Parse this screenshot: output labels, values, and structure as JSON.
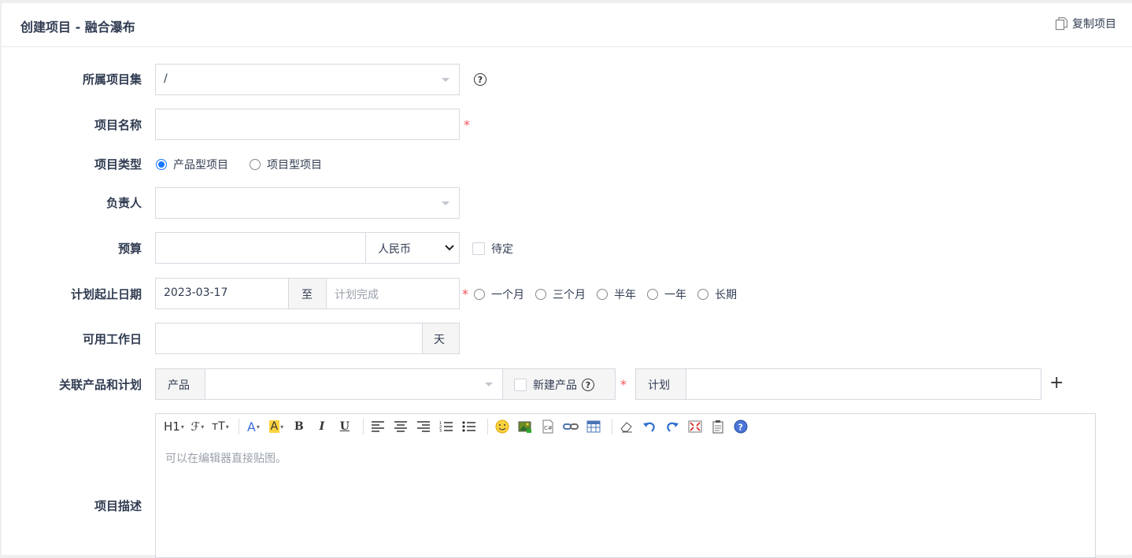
{
  "header": {
    "title": "创建项目 - 融合瀑布",
    "copy_label": "复制项目"
  },
  "form": {
    "program": {
      "label": "所属项目集",
      "value": "/"
    },
    "name": {
      "label": "项目名称",
      "value": ""
    },
    "type": {
      "label": "项目类型",
      "options": [
        "产品型项目",
        "项目型项目"
      ],
      "selected": "产品型项目"
    },
    "owner": {
      "label": "负责人",
      "value": ""
    },
    "budget": {
      "label": "预算",
      "value": "",
      "currency": "人民币",
      "pending_label": "待定"
    },
    "dates": {
      "label": "计划起止日期",
      "begin": "2023-03-17",
      "to": "至",
      "end_placeholder": "计划完成",
      "quick": [
        "一个月",
        "三个月",
        "半年",
        "一年",
        "长期"
      ]
    },
    "workdays": {
      "label": "可用工作日",
      "value": "",
      "unit": "天"
    },
    "products": {
      "label": "关联产品和计划",
      "product_addon": "产品",
      "new_product_label": "新建产品",
      "plan_addon": "计划",
      "add_symbol": "+"
    },
    "desc": {
      "label": "项目描述",
      "placeholder": "可以在编辑器直接贴图。"
    }
  },
  "toolbar": {
    "heading": "H1",
    "font": "ℱ",
    "size": "тT",
    "fore": "A",
    "back": "A",
    "bold": "B",
    "italic": "I",
    "underline": "U"
  },
  "colors": {
    "accent": "#1677ff",
    "required": "#f1525a",
    "border": "#d6d9e0"
  }
}
